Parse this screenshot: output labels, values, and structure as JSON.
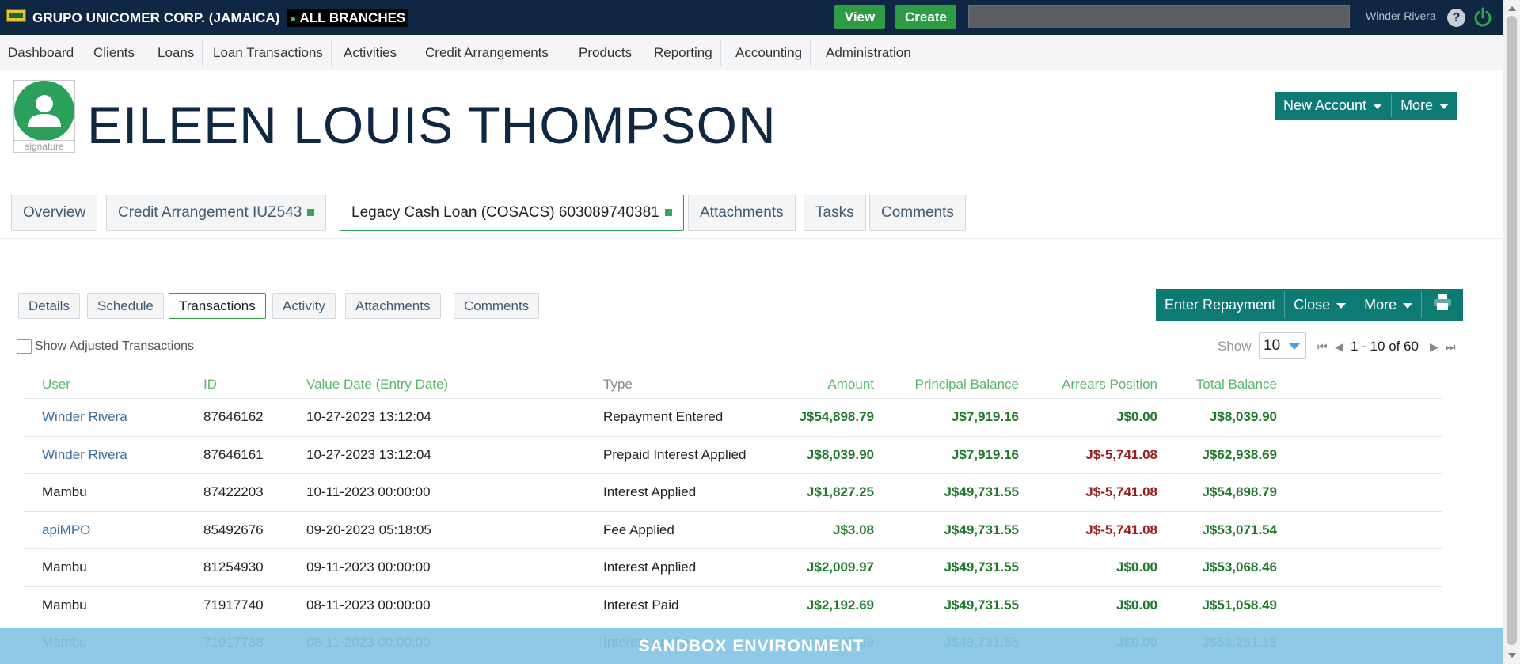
{
  "app": {
    "org_name": "GRUPO UNICOMER CORP. (JAMAICA)",
    "branches": "ALL BRANCHES",
    "view_button": "View",
    "create_button": "Create",
    "search_value": "",
    "username": "Winder Rivera",
    "help_icon_glyph": "?"
  },
  "nav": [
    "Dashboard",
    "Clients",
    "Loans",
    "Loan Transactions",
    "Activities",
    "Credit Arrangements",
    "Products",
    "Reporting",
    "Accounting",
    "Administration"
  ],
  "client": {
    "name": "EILEEN LOUIS THOMPSON",
    "signature_label": "signature",
    "new_account_button": "New Account",
    "more_button": "More"
  },
  "main_tabs": [
    {
      "label": "Overview"
    },
    {
      "label": "Credit Arrangement IUZ543"
    },
    {
      "label": "Legacy Cash Loan (COSACS) 603089740381"
    },
    {
      "label": "Attachments"
    },
    {
      "label": "Tasks"
    },
    {
      "label": "Comments"
    }
  ],
  "sub_tabs": [
    "Details",
    "Schedule",
    "Transactions",
    "Activity",
    "Attachments",
    "Comments"
  ],
  "actions": {
    "enter_repayment": "Enter Repayment",
    "close": "Close",
    "more": "More"
  },
  "filters": {
    "show_adjusted": "Show Adjusted Transactions",
    "show_label": "Show",
    "page_size": "10",
    "pager": "1 - 10 of 60"
  },
  "table": {
    "headers": [
      "User",
      "ID",
      "Value Date (Entry Date)",
      "Type",
      "Amount",
      "Principal Balance",
      "Arrears Position",
      "Total Balance"
    ],
    "rows": [
      [
        "Winder Rivera",
        "87646162",
        "10-27-2023 13:12:04",
        "Repayment Entered",
        "J$54,898.79",
        "J$7,919.16",
        "J$0.00",
        "J$8,039.90"
      ],
      [
        "Winder Rivera",
        "87646161",
        "10-27-2023 13:12:04",
        "Prepaid Interest Applied",
        "J$8,039.90",
        "J$7,919.16",
        "J$-5,741.08",
        "J$62,938.69"
      ],
      [
        "Mambu",
        "87422203",
        "10-11-2023 00:00:00",
        "Interest Applied",
        "J$1,827.25",
        "J$49,731.55",
        "J$-5,741.08",
        "J$54,898.79"
      ],
      [
        "apiMPO",
        "85492676",
        "09-20-2023 05:18:05",
        "Fee Applied",
        "J$3.08",
        "J$49,731.55",
        "J$-5,741.08",
        "J$53,071.54"
      ],
      [
        "Mambu",
        "81254930",
        "09-11-2023 00:00:00",
        "Interest Applied",
        "J$2,009.97",
        "J$49,731.55",
        "J$0.00",
        "J$53,068.46"
      ],
      [
        "Mambu",
        "71917740",
        "08-11-2023 00:00:00",
        "Interest Paid",
        "J$2,192.69",
        "J$49,731.55",
        "J$0.00",
        "J$51,058.49"
      ],
      [
        "Mambu",
        "71917738",
        "08-11-2023 00:00:00",
        "Interest Applied",
        "J$2,192.69",
        "J$49,731.55",
        "J$0.00",
        "J$53,251.18"
      ]
    ]
  },
  "sandbox_banner": "SANDBOX ENVIRONMENT",
  "colors": {
    "topbar": "#0f2742",
    "brand_green": "#2f9b47",
    "teal": "#0e7a74",
    "positive": "#1f7a2a",
    "negative": "#9b1c1c",
    "link": "#3b6fa0"
  }
}
